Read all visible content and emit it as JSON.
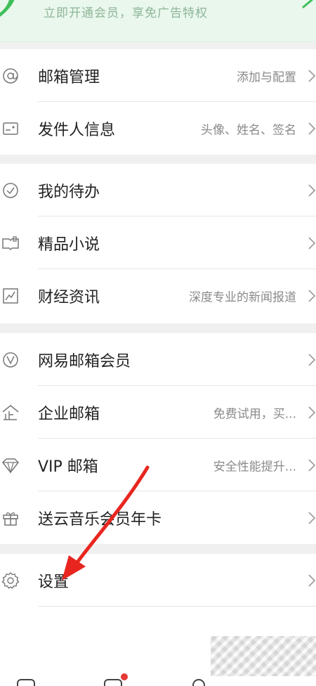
{
  "banner": {
    "promo_text": "立即开通会员，享免广告特权",
    "brand_color": "#3fbf5a"
  },
  "menu": {
    "groups": [
      {
        "items": [
          {
            "label": "邮箱管理",
            "desc": "添加与配置",
            "icon": "at-icon"
          },
          {
            "label": "发件人信息",
            "desc": "头像、姓名、签名",
            "icon": "id-card-icon"
          }
        ]
      },
      {
        "items": [
          {
            "label": "我的待办",
            "desc": "",
            "icon": "check-circle-icon"
          },
          {
            "label": "精品小说",
            "desc": "",
            "icon": "book-icon"
          },
          {
            "label": "财经资讯",
            "desc": "深度专业的新闻报道",
            "icon": "chart-icon"
          }
        ]
      },
      {
        "items": [
          {
            "label": "网易邮箱会员",
            "desc": "",
            "icon": "v-badge-icon"
          },
          {
            "label": "企业邮箱",
            "desc": "免费试用，买...",
            "icon": "enterprise-icon"
          },
          {
            "label": "VIP 邮箱",
            "desc": "安全性能提升...",
            "icon": "diamond-icon"
          },
          {
            "label": "送云音乐会员年卡",
            "desc": "",
            "icon": "gift-icon"
          }
        ]
      },
      {
        "items": [
          {
            "label": "设置",
            "desc": "",
            "icon": "gear-icon"
          }
        ]
      }
    ]
  },
  "annotation": {
    "arrow_color": "#e8261f"
  },
  "tabbar": {
    "badge_color": "#e53935"
  }
}
